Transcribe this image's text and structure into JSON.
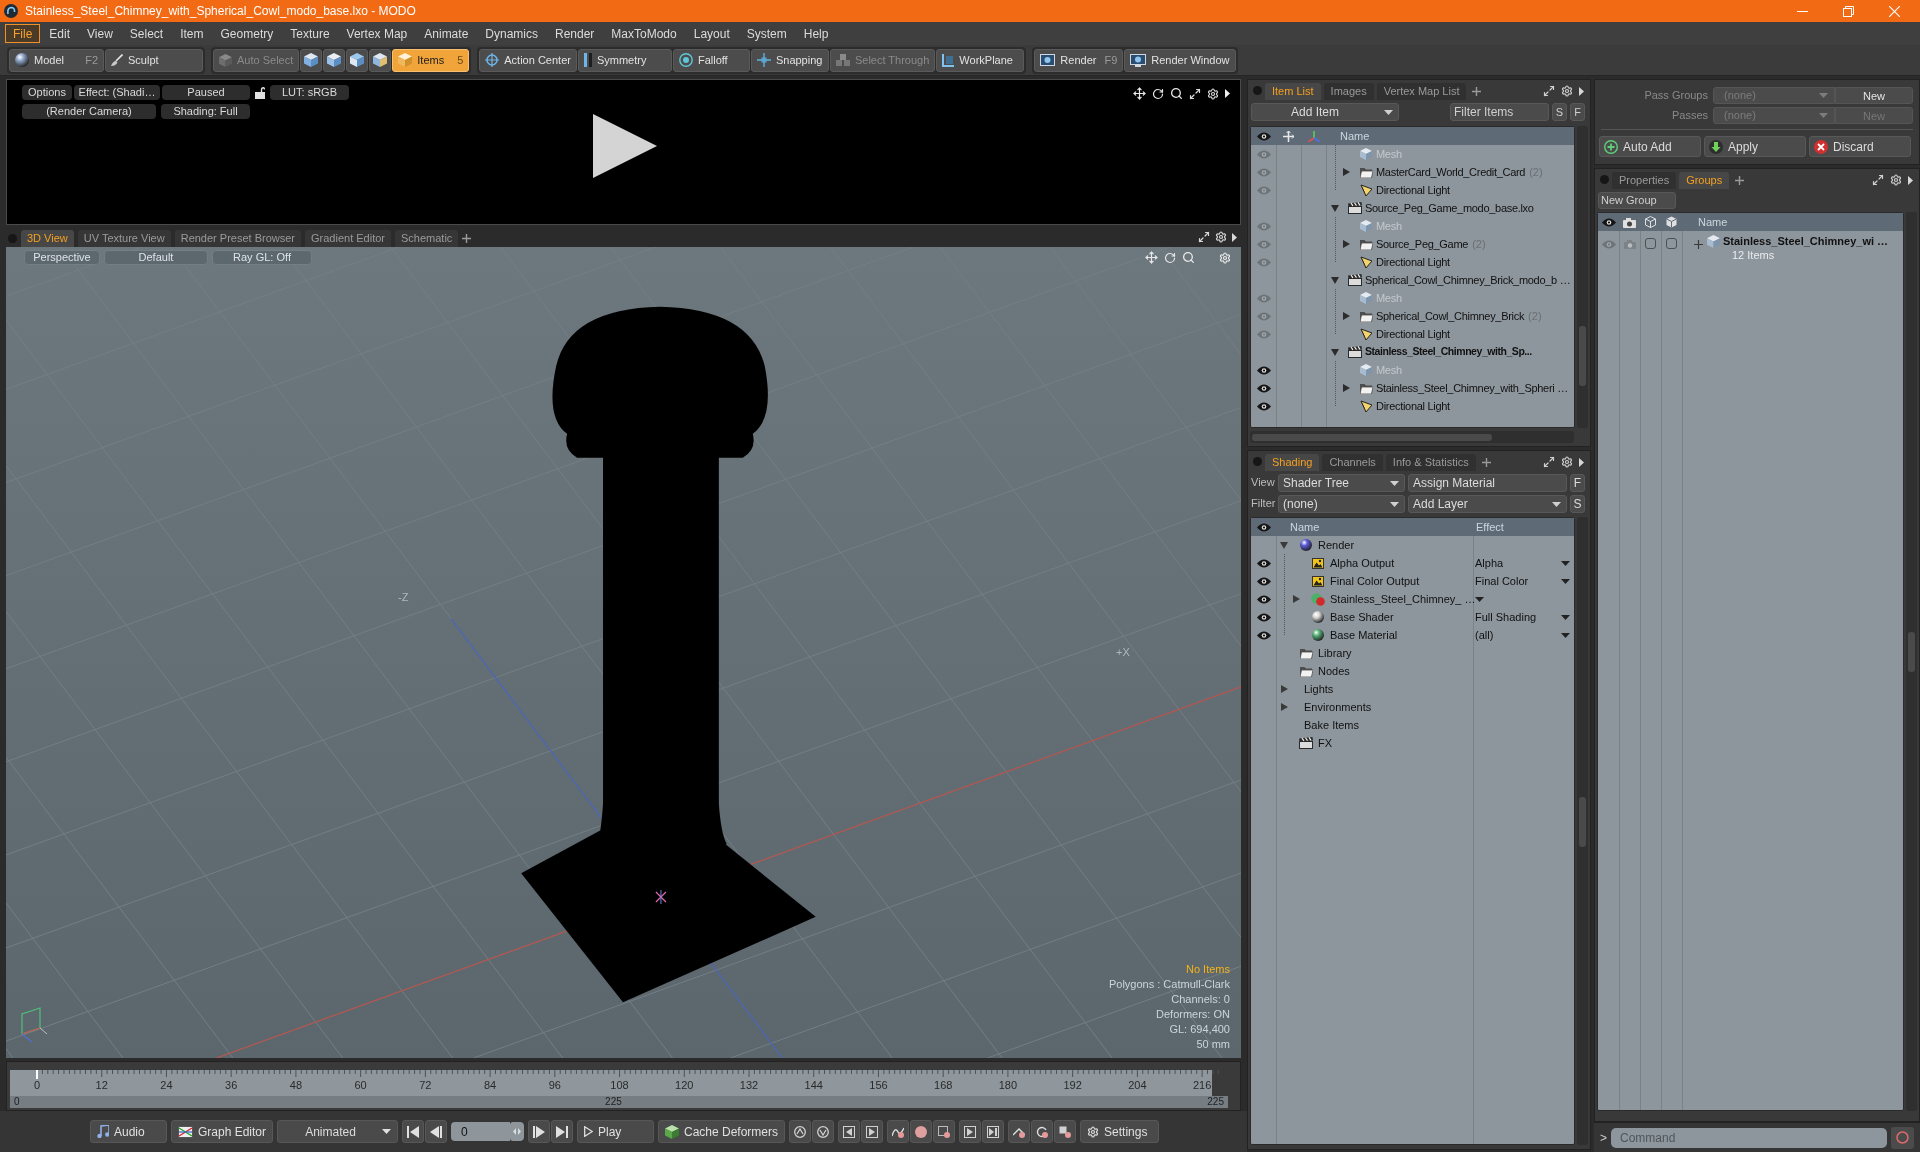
{
  "window": {
    "title": "Stainless_Steel_Chimney_with_Spherical_Cowl_modo_base.lxo - MODO"
  },
  "menu": [
    {
      "label": "File",
      "selected": true
    },
    {
      "label": "Edit",
      "selected": false
    },
    {
      "label": "View",
      "selected": false
    },
    {
      "label": "Select",
      "selected": false
    },
    {
      "label": "Item",
      "selected": false
    },
    {
      "label": "Geometry",
      "selected": false
    },
    {
      "label": "Texture",
      "selected": false
    },
    {
      "label": "Vertex Map",
      "selected": false
    },
    {
      "label": "Animate",
      "selected": false
    },
    {
      "label": "Dynamics",
      "selected": false
    },
    {
      "label": "Render",
      "selected": false
    },
    {
      "label": "MaxToModo",
      "selected": false
    },
    {
      "label": "Layout",
      "selected": false
    },
    {
      "label": "System",
      "selected": false
    },
    {
      "label": "Help",
      "selected": false
    }
  ],
  "toolbar": [
    {
      "items": [
        {
          "kind": "button",
          "label": "Model",
          "shortcut": "F2",
          "disabled": false
        },
        {
          "kind": "button",
          "label": "Sculpt",
          "disabled": false
        }
      ]
    },
    {
      "items": [
        {
          "kind": "button",
          "label": "Auto Select",
          "disabled": true
        },
        {
          "kind": "icon",
          "selected": false
        },
        {
          "kind": "icon",
          "selected": false
        },
        {
          "kind": "icon",
          "selected": false
        },
        {
          "kind": "icon",
          "selected": false
        },
        {
          "kind": "button",
          "label": "Items",
          "shortcut": "5",
          "selected": true,
          "disabled": false
        }
      ]
    },
    {
      "items": [
        {
          "kind": "button",
          "label": "Action Center",
          "disabled": false
        },
        {
          "kind": "button",
          "label": "Symmetry",
          "disabled": false
        },
        {
          "kind": "button",
          "label": "Falloff",
          "disabled": false
        },
        {
          "kind": "button",
          "label": "Snapping",
          "disabled": false
        },
        {
          "kind": "button",
          "label": "Select Through",
          "disabled": true
        },
        {
          "kind": "button",
          "label": "WorkPlane",
          "disabled": false
        }
      ]
    },
    {
      "items": [
        {
          "kind": "button",
          "label": "Render",
          "shortcut": "F9",
          "disabled": false
        },
        {
          "kind": "button",
          "label": "Render Window",
          "disabled": false
        }
      ]
    }
  ],
  "render_preview": {
    "controls": [
      {
        "kind": "button",
        "label": "Options"
      },
      {
        "kind": "button",
        "label": "Effect: (Shadi…"
      },
      {
        "kind": "button",
        "label": "Paused"
      },
      {
        "kind": "lock",
        "locked": false
      },
      {
        "kind": "button",
        "label": "LUT: sRGB"
      }
    ],
    "camera_controls": [
      {
        "kind": "button",
        "label": "(Render Camera)"
      },
      {
        "kind": "button",
        "label": "Shading: Full"
      }
    ]
  },
  "viewport": {
    "tabs": [
      {
        "label": "3D View",
        "selected": true
      },
      {
        "label": "UV Texture View",
        "selected": false
      },
      {
        "label": "Render Preset Browser",
        "selected": false
      },
      {
        "label": "Gradient Editor",
        "selected": false
      },
      {
        "label": "Schematic",
        "selected": false
      }
    ],
    "view_controls": [
      "Perspective",
      "Default",
      "Ray GL: Off"
    ],
    "axis_labels": [
      "-Z",
      "+X"
    ],
    "info": {
      "status": "No Items",
      "lines": [
        "Polygons : Catmull-Clark",
        "Channels: 0",
        "Deformers: ON",
        "GL: 694,400",
        "50 mm"
      ]
    }
  },
  "timeline": {
    "ticks": [
      "0",
      "12",
      "24",
      "36",
      "48",
      "60",
      "72",
      "84",
      "96",
      "108",
      "120",
      "132",
      "144",
      "156",
      "168",
      "180",
      "192",
      "204",
      "216"
    ],
    "range_start": "0",
    "range_mid": "225",
    "range_end": "225"
  },
  "transport": [
    {
      "items": [
        {
          "kind": "button",
          "label": "Audio"
        }
      ]
    },
    {
      "items": [
        {
          "kind": "button",
          "label": "Graph Editor"
        }
      ]
    },
    {
      "items": [
        {
          "kind": "dropdown",
          "label": "Animated"
        }
      ]
    },
    {
      "items": [
        {
          "kind": "icon"
        },
        {
          "kind": "icon"
        }
      ]
    },
    {
      "items": [
        {
          "kind": "field",
          "value": "0"
        }
      ]
    },
    {
      "items": [
        {
          "kind": "icon"
        },
        {
          "kind": "icon"
        }
      ]
    },
    {
      "items": [
        {
          "kind": "button",
          "label": "Play"
        }
      ]
    },
    {
      "items": [
        {
          "kind": "button",
          "label": "Cache Deformers"
        }
      ]
    },
    {
      "items": [
        {
          "kind": "icon"
        },
        {
          "kind": "icon"
        }
      ]
    },
    {
      "items": [
        {
          "kind": "icon"
        },
        {
          "kind": "icon"
        }
      ]
    },
    {
      "items": [
        {
          "kind": "icon"
        },
        {
          "kind": "icon"
        },
        {
          "kind": "icon"
        }
      ]
    },
    {
      "items": [
        {
          "kind": "icon"
        },
        {
          "kind": "icon"
        }
      ]
    },
    {
      "items": [
        {
          "kind": "icon"
        },
        {
          "kind": "icon"
        },
        {
          "kind": "icon"
        }
      ]
    },
    {
      "items": [
        {
          "kind": "button",
          "label": "Settings"
        }
      ]
    }
  ],
  "item_list": {
    "tabs": [
      {
        "label": "Item List",
        "selected": true
      },
      {
        "label": "Images",
        "selected": false
      },
      {
        "label": "Vertex Map List",
        "selected": false
      }
    ],
    "add_item": "Add Item",
    "filter_placeholder": "Filter Items",
    "toggles": [
      "S",
      "F"
    ],
    "column": "Name",
    "partial_scene": {
      "children": [
        {
          "kind": "mesh",
          "name": "Mesh",
          "visible": true,
          "disabled": true
        },
        {
          "kind": "group",
          "name": "MasterCard_World_Credit_Card",
          "count": "(2)",
          "visible": true,
          "disabled": false,
          "expanded": false
        },
        {
          "kind": "light",
          "name": "Directional Light",
          "visible": true,
          "disabled": false
        }
      ]
    },
    "scenes": [
      {
        "kind": "scene",
        "name": "Source_Peg_Game_modo_base.lxo",
        "active": false,
        "expanded": true,
        "children": [
          {
            "kind": "mesh",
            "name": "Mesh",
            "visible": true,
            "disabled": true
          },
          {
            "kind": "group",
            "name": "Source_Peg_Game",
            "count": "(2)",
            "visible": true,
            "disabled": false,
            "expanded": false
          },
          {
            "kind": "light",
            "name": "Directional Light",
            "visible": true,
            "disabled": false
          }
        ]
      },
      {
        "kind": "scene",
        "name": "Spherical_Cowl_Chimney_Brick_modo_b …",
        "active": false,
        "expanded": true,
        "children": [
          {
            "kind": "mesh",
            "name": "Mesh",
            "visible": true,
            "disabled": true
          },
          {
            "kind": "group",
            "name": "Spherical_Cowl_Chimney_Brick",
            "count": "(2)",
            "visible": true,
            "disabled": false,
            "expanded": false
          },
          {
            "kind": "light",
            "name": "Directional Light",
            "visible": true,
            "disabled": false
          }
        ]
      },
      {
        "kind": "scene",
        "name": "Stainless_Steel_Chimney_with_Sp...",
        "active": true,
        "expanded": true,
        "children": [
          {
            "kind": "mesh",
            "name": "Mesh",
            "visible": true,
            "disabled": true
          },
          {
            "kind": "group",
            "name": "Stainless_Steel_Chimney_with_Spheri …",
            "visible": true,
            "disabled": false,
            "expanded": false
          },
          {
            "kind": "light",
            "name": "Directional Light",
            "visible": true,
            "disabled": false
          }
        ]
      }
    ]
  },
  "shading": {
    "tabs": [
      {
        "label": "Shading",
        "selected": true
      },
      {
        "label": "Channels",
        "selected": false
      },
      {
        "label": "Info & Statistics",
        "selected": false
      }
    ],
    "view_label": "View",
    "view": "Shader Tree",
    "assign": "Assign Material",
    "view_toggle": "F",
    "filter_label": "Filter",
    "filter": "(none)",
    "add_layer": "Add Layer",
    "filter_toggle": "S",
    "columns": [
      "Name",
      "Effect"
    ],
    "tree": [
      {
        "kind": "render",
        "name": "Render",
        "expanded": true,
        "children": [
          {
            "kind": "output",
            "name": "Alpha Output",
            "effect": "Alpha",
            "visible": true
          },
          {
            "kind": "output",
            "name": "Final Color Output",
            "effect": "Final Color",
            "visible": true
          },
          {
            "kind": "material_group",
            "name": "Stainless_Steel_Chimney_ …",
            "visible": true,
            "expanded": false
          },
          {
            "kind": "shader",
            "name": "Base Shader",
            "effect": "Full Shading",
            "visible": true
          },
          {
            "kind": "material",
            "name": "Base Material",
            "effect": "(all)",
            "visible": true
          }
        ]
      },
      {
        "kind": "folder",
        "name": "Library"
      },
      {
        "kind": "folder",
        "name": "Nodes"
      },
      {
        "kind": "group",
        "name": "Lights",
        "expanded": false
      },
      {
        "kind": "group",
        "name": "Environments",
        "expanded": false
      },
      {
        "kind": "group",
        "name": "Bake Items"
      },
      {
        "kind": "effects",
        "name": "FX"
      }
    ]
  },
  "passes": {
    "rows": [
      {
        "label": "Pass Groups",
        "value": "(none)",
        "button": "New",
        "disabled": false
      },
      {
        "label": "Passes",
        "value": "(none)",
        "button": "New",
        "disabled": true
      }
    ],
    "actions": [
      "Auto Add",
      "Apply",
      "Discard"
    ]
  },
  "groups_panel": {
    "tabs": [
      {
        "label": "Properties",
        "selected": false
      },
      {
        "label": "Groups",
        "selected": true
      }
    ],
    "new_group": "New Group",
    "column": "Name",
    "rows": [
      {
        "name": "Stainless_Steel_Chimney_wi …",
        "count": "12 Items",
        "visible": true,
        "expanded": false,
        "toggles": [
          {
            "checked": false
          },
          {
            "checked": false
          }
        ]
      }
    ]
  },
  "command": {
    "prompt": ">",
    "placeholder": "Command"
  }
}
